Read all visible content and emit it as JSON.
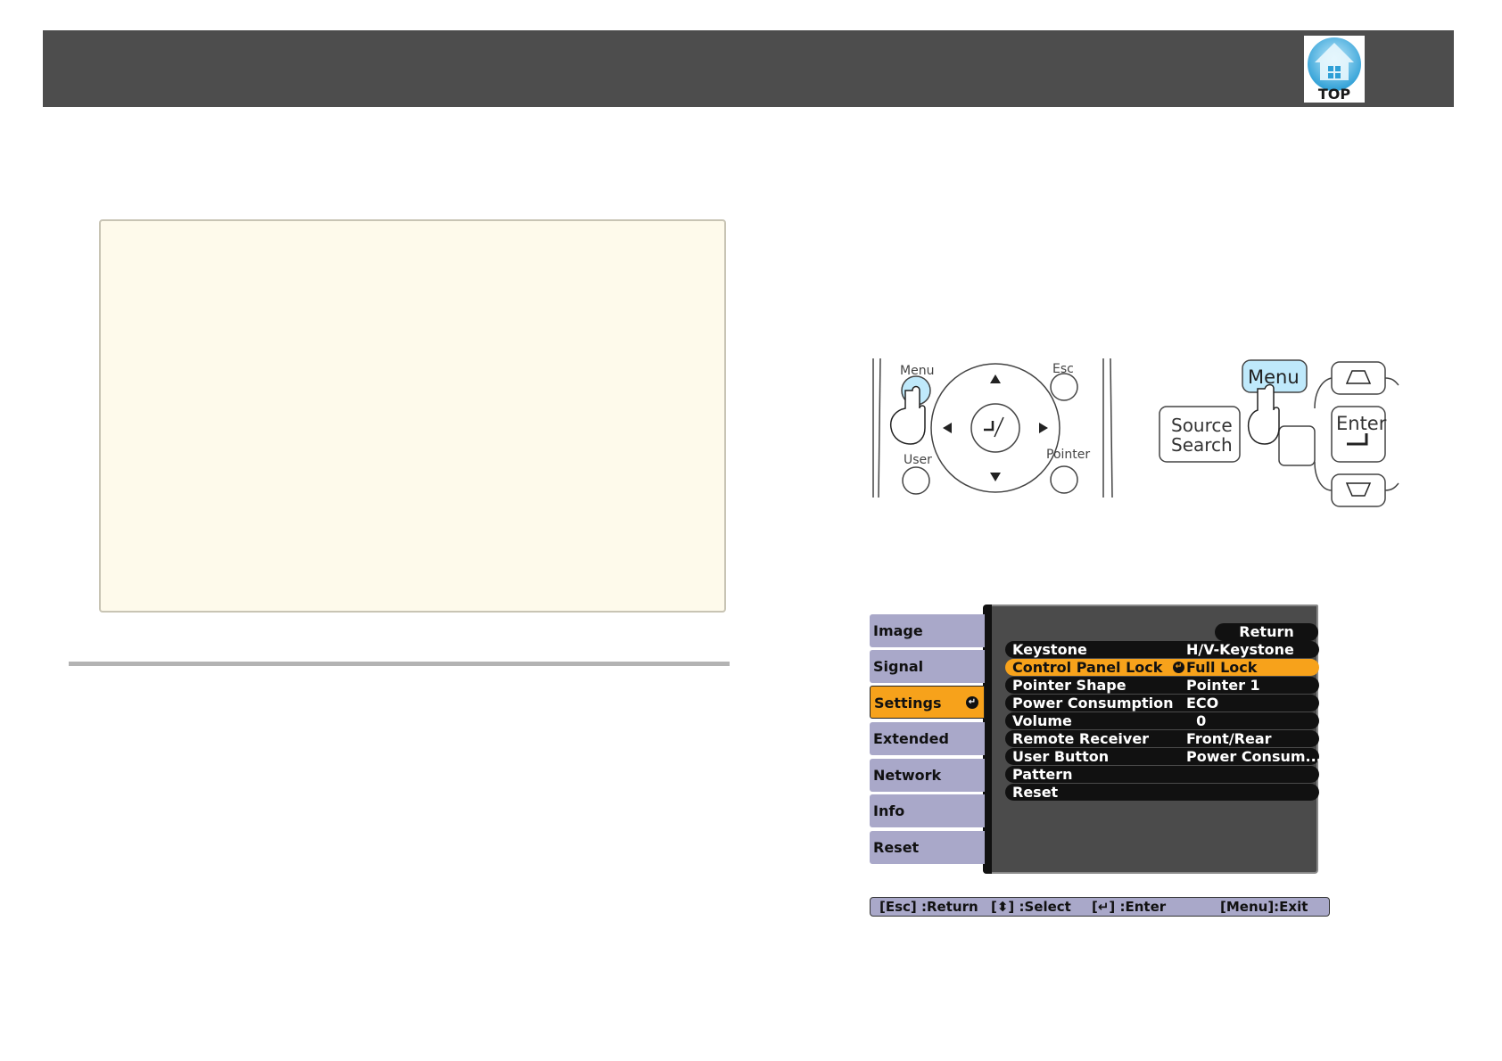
{
  "header": {
    "top_label": "TOP"
  },
  "remote": {
    "menu": "Menu",
    "esc": "Esc",
    "user": "User",
    "pointer": "Pointer"
  },
  "panel": {
    "menu": "Menu",
    "source_line1": "Source",
    "source_line2": "Search",
    "enter": "Enter"
  },
  "osd": {
    "tabs": [
      "Image",
      "Signal",
      "Settings",
      "Extended",
      "Network",
      "Info",
      "Reset"
    ],
    "active_tab": "Settings",
    "return_label": "Return",
    "rows": [
      {
        "label": "Keystone",
        "value": "H/V-Keystone"
      },
      {
        "label": "Control Panel Lock",
        "value": "Full Lock"
      },
      {
        "label": "Pointer Shape",
        "value": "Pointer 1"
      },
      {
        "label": "Power Consumption",
        "value": "ECO"
      },
      {
        "label": "Volume",
        "value": "  0"
      },
      {
        "label": "Remote Receiver",
        "value": "Front/Rear"
      },
      {
        "label": "User Button",
        "value": "Power Consum..."
      },
      {
        "label": "Pattern",
        "value": ""
      },
      {
        "label": "Reset",
        "value": ""
      }
    ],
    "highlighted_row": "Control Panel Lock",
    "help": {
      "esc": "[Esc] :Return",
      "select": "[⬍] :Select",
      "enter": "[↵] :Enter",
      "exit": "[Menu]:Exit"
    },
    "colors": {
      "highlight": "#f7a21b",
      "tab": "#a9a8c9",
      "panel": "#4b4b4b"
    }
  }
}
